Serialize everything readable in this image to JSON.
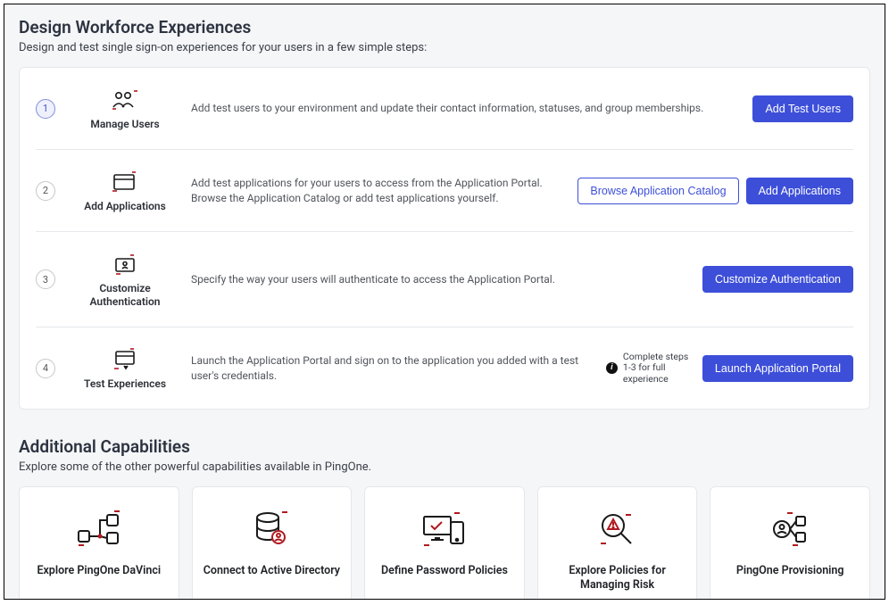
{
  "header": {
    "title": "Design Workforce Experiences",
    "subtitle": "Design and test single sign-on experiences for your users in a few simple steps:"
  },
  "steps": [
    {
      "num": "1",
      "active": true,
      "icon": "users-icon",
      "label": "Manage Users",
      "desc": "Add test users to your environment and update their contact information, statuses, and group memberships.",
      "actions": {
        "primary": "Add Test Users"
      }
    },
    {
      "num": "2",
      "active": false,
      "icon": "applications-icon",
      "label": "Add Applications",
      "desc": "Add test applications for your users to access from the Application Portal. Browse the Application Catalog or add test applications yourself.",
      "actions": {
        "outline": "Browse Application Catalog",
        "primary": "Add Applications"
      }
    },
    {
      "num": "3",
      "active": false,
      "icon": "auth-icon",
      "label": "Customize Authentication",
      "desc": "Specify the way your users will authenticate to access the Application Portal.",
      "actions": {
        "primary": "Customize Authentication"
      }
    },
    {
      "num": "4",
      "active": false,
      "icon": "test-icon",
      "label": "Test Experiences",
      "desc": "Launch the Application Portal and sign on to the application you added with a test user's credentials.",
      "hint": "Complete steps 1-3 for full experience",
      "actions": {
        "primary": "Launch Application Portal"
      }
    }
  ],
  "additional": {
    "title": "Additional Capabilities",
    "subtitle": "Explore some of the other powerful capabilities available in PingOne."
  },
  "capabilities": [
    {
      "icon": "davinci-icon",
      "label": "Explore PingOne DaVinci"
    },
    {
      "icon": "directory-icon",
      "label": "Connect to Active Directory"
    },
    {
      "icon": "password-icon",
      "label": "Define Password Policies"
    },
    {
      "icon": "risk-icon",
      "label": "Explore Policies for Managing Risk"
    },
    {
      "icon": "provisioning-icon",
      "label": "PingOne Provisioning"
    }
  ]
}
